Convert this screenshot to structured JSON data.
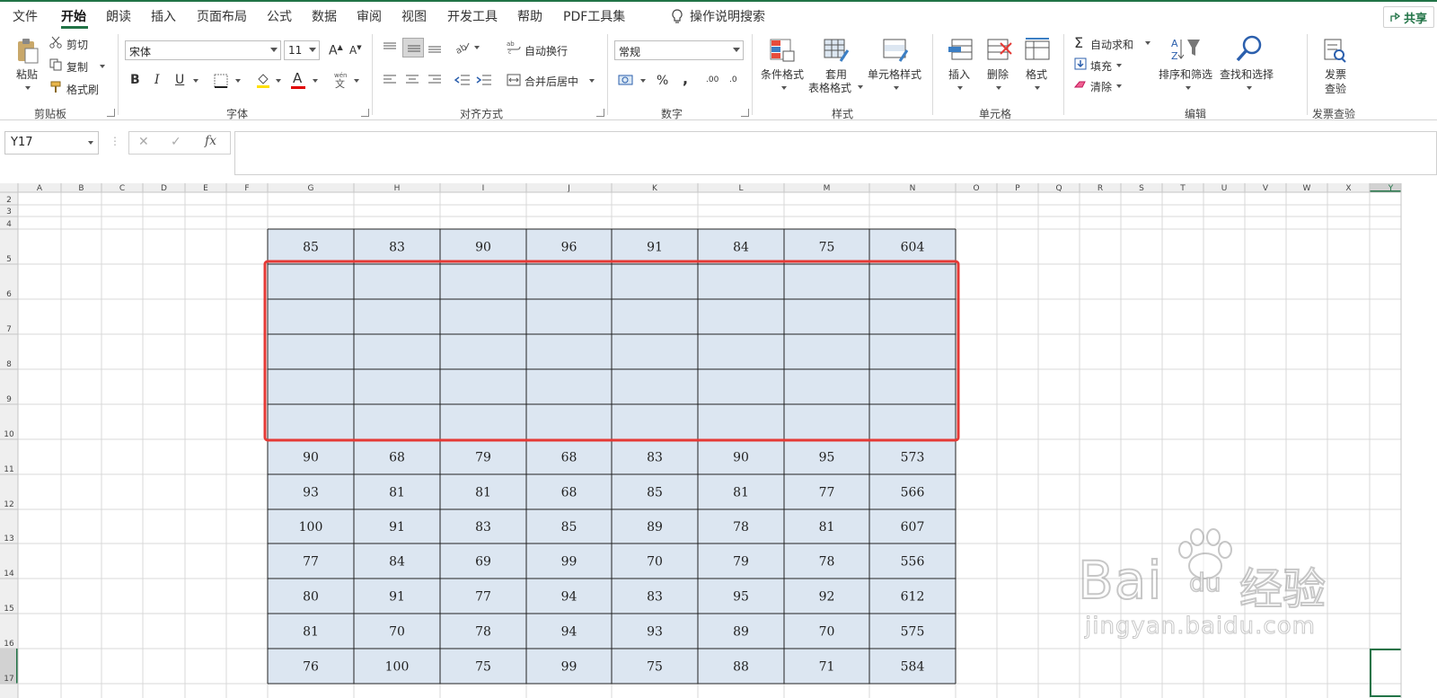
{
  "menu": {
    "tabs": [
      "文件",
      "开始",
      "朗读",
      "插入",
      "页面布局",
      "公式",
      "数据",
      "审阅",
      "视图",
      "开发工具",
      "帮助",
      "PDF工具集"
    ],
    "active_tab": "开始",
    "tell_me": "操作说明搜索",
    "share": "共享"
  },
  "ribbon": {
    "clipboard": {
      "paste": "粘贴",
      "cut": "剪切",
      "copy": "复制",
      "format_painter": "格式刷",
      "label": "剪贴板"
    },
    "font": {
      "font_name": "宋体",
      "font_size": "11",
      "label": "字体",
      "bold": "B",
      "italic": "I",
      "underline": "U",
      "font_color_letter": "A",
      "wen": "wén\n文"
    },
    "alignment": {
      "wrap_text": "自动换行",
      "merge_center": "合并后居中",
      "label": "对齐方式"
    },
    "number": {
      "format": "常规",
      "percent": "%",
      "comma": ",",
      "inc_decimal": ".00",
      "dec_decimal": ".0",
      "label": "数字"
    },
    "styles": {
      "conditional": "条件格式",
      "table_format_line1": "套用",
      "table_format_line2": "表格格式",
      "cell_styles": "单元格样式",
      "label": "样式"
    },
    "cells": {
      "insert": "插入",
      "delete": "删除",
      "format": "格式",
      "label": "单元格"
    },
    "editing": {
      "autosum": "自动求和",
      "fill": "填充",
      "clear": "清除",
      "sort_filter": "排序和筛选",
      "find_select": "查找和选择",
      "label": "编辑"
    },
    "invoice": {
      "line1": "发票",
      "line2": "查验",
      "label": "发票查验"
    }
  },
  "formula_bar": {
    "name_box": "Y17",
    "cancel": "✕",
    "enter": "✓",
    "fx": "fx",
    "formula": ""
  },
  "sheet": {
    "columns": [
      "A",
      "B",
      "C",
      "D",
      "E",
      "F",
      "G",
      "H",
      "I",
      "J",
      "K",
      "L",
      "M",
      "N",
      "O",
      "P",
      "Q",
      "R",
      "S",
      "T",
      "U",
      "V",
      "W",
      "X",
      "Y"
    ],
    "rows": [
      "2",
      "3",
      "4",
      "5",
      "6",
      "7",
      "8",
      "9",
      "10",
      "11",
      "12",
      "13",
      "14",
      "15",
      "16",
      "17"
    ],
    "selected_cell": "Y17",
    "table_rows": [
      {
        "row": "5",
        "values": [
          "85",
          "83",
          "90",
          "96",
          "91",
          "84",
          "75",
          "604"
        ]
      },
      {
        "row": "6",
        "values": [
          "",
          "",
          "",
          "",
          "",
          "",
          "",
          ""
        ]
      },
      {
        "row": "7",
        "values": [
          "",
          "",
          "",
          "",
          "",
          "",
          "",
          ""
        ]
      },
      {
        "row": "8",
        "values": [
          "",
          "",
          "",
          "",
          "",
          "",
          "",
          ""
        ]
      },
      {
        "row": "9",
        "values": [
          "",
          "",
          "",
          "",
          "",
          "",
          "",
          ""
        ]
      },
      {
        "row": "10",
        "values": [
          "",
          "",
          "",
          "",
          "",
          "",
          "",
          ""
        ]
      },
      {
        "row": "11",
        "values": [
          "90",
          "68",
          "79",
          "68",
          "83",
          "90",
          "95",
          "573"
        ]
      },
      {
        "row": "12",
        "values": [
          "93",
          "81",
          "81",
          "68",
          "85",
          "81",
          "77",
          "566"
        ]
      },
      {
        "row": "13",
        "values": [
          "100",
          "91",
          "83",
          "85",
          "89",
          "78",
          "81",
          "607"
        ]
      },
      {
        "row": "14",
        "values": [
          "77",
          "84",
          "69",
          "99",
          "70",
          "79",
          "78",
          "556"
        ]
      },
      {
        "row": "15",
        "values": [
          "80",
          "91",
          "77",
          "94",
          "83",
          "95",
          "92",
          "612"
        ]
      },
      {
        "row": "16",
        "values": [
          "81",
          "70",
          "78",
          "94",
          "93",
          "89",
          "70",
          "575"
        ]
      },
      {
        "row": "17",
        "values": [
          "76",
          "100",
          "75",
          "99",
          "75",
          "88",
          "71",
          "584"
        ]
      }
    ],
    "highlight_color": "#e53935",
    "table_fill": "#dce6f1"
  },
  "watermark": {
    "line1": "Bai",
    "paw": "du",
    "cn": "经验",
    "line2": "jingyan.baidu.com"
  }
}
